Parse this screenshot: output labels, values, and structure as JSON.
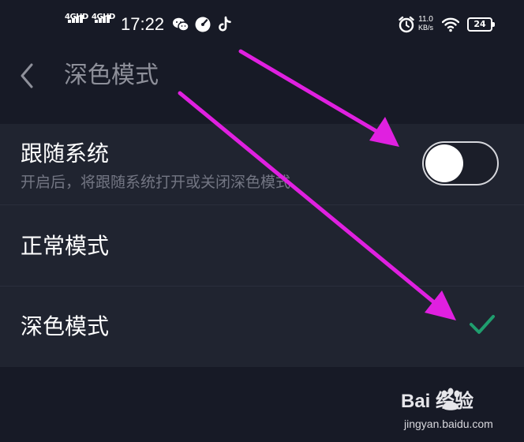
{
  "status_bar": {
    "network_1": "4GHD",
    "network_2": "4GHD",
    "time": "17:22",
    "net_speed_value": "11.0",
    "net_speed_unit": "KB/s",
    "battery": "24",
    "icons": [
      "signal-icon",
      "wechat-icon",
      "speedometer-icon",
      "tiktok-icon",
      "alarm-icon",
      "wifi-icon",
      "battery-icon"
    ]
  },
  "header": {
    "title": "深色模式",
    "back_icon": "chevron-left-icon"
  },
  "follow_system": {
    "title": "跟随系统",
    "subtitle": "开启后，将跟随系统打开或关闭深色模式",
    "toggle_on": false
  },
  "options": [
    {
      "label": "正常模式",
      "selected": false
    },
    {
      "label": "深色模式",
      "selected": true
    }
  ],
  "watermark": {
    "brand": "Bai 经验",
    "url": "jingyan.baidu.com"
  },
  "colors": {
    "background": "#171a26",
    "row_background": "#202430",
    "check": "#1f9e6e",
    "annotation_arrow": "#e020e0"
  }
}
